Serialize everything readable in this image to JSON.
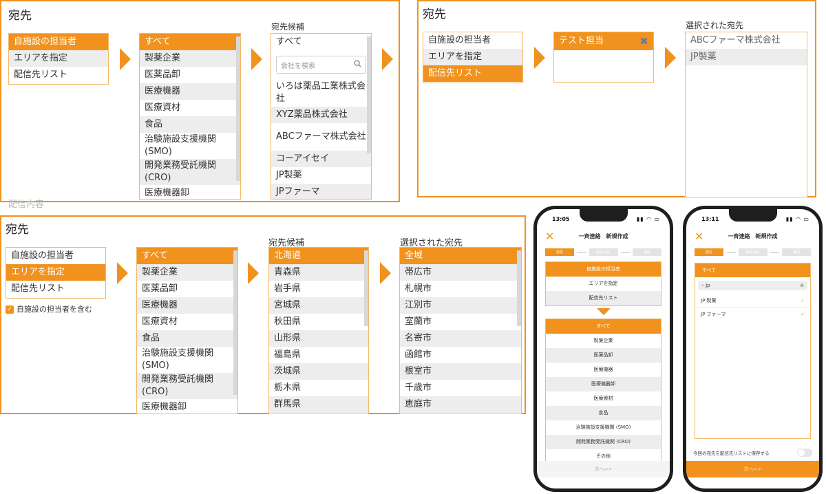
{
  "p1": {
    "title": "宛先",
    "types": [
      "自施設の担当者",
      "エリアを指定",
      "配信先リスト"
    ],
    "categories": [
      "すべて",
      "製薬企業",
      "医薬品卸",
      "医療機器",
      "医療資材",
      "食品",
      "治験施設支援機関(SMO)",
      "開発業務受託機関(CRO)",
      "医療機器卸"
    ],
    "cand_label": "宛先候補",
    "cand_first": "すべて",
    "search_ph": "会社を検索",
    "candidates": [
      "いろは薬品工業株式会社",
      "XYZ薬品株式会社",
      "ABCファーマ株式会社",
      "コーアイセイ",
      "JP製薬",
      "JPファーマ"
    ],
    "cut_text": "配信内容"
  },
  "p2": {
    "title": "宛先",
    "types": [
      "自施設の担当者",
      "エリアを指定",
      "配信先リスト"
    ],
    "list_item": "テスト担当",
    "sel_label": "選択された宛先",
    "selected": [
      "ABCファーマ株式会社",
      "JP製薬"
    ]
  },
  "p3": {
    "title": "宛先",
    "types": [
      "自施設の担当者",
      "エリアを指定",
      "配信先リスト"
    ],
    "checkbox": "自施設の担当者を含む",
    "categories": [
      "すべて",
      "製薬企業",
      "医薬品卸",
      "医療機器",
      "医療資材",
      "食品",
      "治験施設支援機関(SMO)",
      "開発業務受託機関(CRO)",
      "医療機器卸"
    ],
    "cand_label": "宛先候補",
    "prefs": [
      "北海道",
      "青森県",
      "岩手県",
      "宮城県",
      "秋田県",
      "山形県",
      "福島県",
      "茨城県",
      "栃木県",
      "群馬県"
    ],
    "sel_label": "選択された宛先",
    "cities": [
      "全域",
      "帯広市",
      "札幌市",
      "江別市",
      "室蘭市",
      "名寄市",
      "函館市",
      "根室市",
      "千歳市",
      "恵庭市"
    ]
  },
  "phone1": {
    "time": "13:05",
    "header": "一斉連絡　新規作成",
    "steps": [
      "宛先",
      "配信内容",
      "確認"
    ],
    "types": [
      "自施設の担当者",
      "エリアを指定",
      "配信先リスト"
    ],
    "categories": [
      "すべて",
      "製薬企業",
      "医薬品卸",
      "医療機器",
      "医療機器卸",
      "医療資材",
      "食品",
      "治験施設支援機関 (SMO)",
      "開発業務受託機関 (CRO)",
      "その他"
    ],
    "next": "次へ>>"
  },
  "phone2": {
    "time": "13:11",
    "header": "一斉連絡　新規作成",
    "steps": [
      "宛先",
      "配信内容",
      "確認"
    ],
    "top": "すべて",
    "search": "Jp",
    "results": [
      "JP 製薬",
      "JP ファーマ"
    ],
    "save": "今回の宛先を配信先リストに保存する",
    "next": "次へ>>"
  },
  "colors": {
    "accent": "#f0921d",
    "alt_row": "#ededed",
    "border": "#f5b866"
  }
}
